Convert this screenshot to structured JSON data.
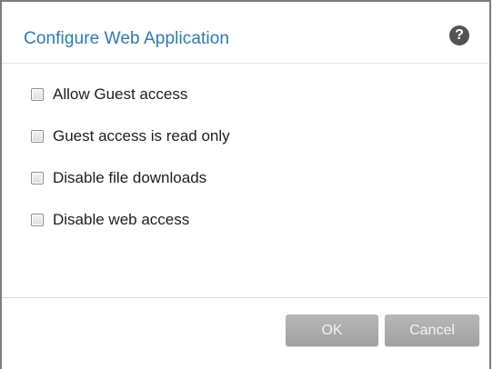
{
  "dialog": {
    "title": "Configure Web Application",
    "help_icon": "help-icon"
  },
  "options": [
    {
      "label": "Allow Guest access",
      "checked": false
    },
    {
      "label": "Guest access is read only",
      "checked": false
    },
    {
      "label": "Disable file downloads",
      "checked": false
    },
    {
      "label": "Disable web access",
      "checked": false
    }
  ],
  "footer": {
    "ok_label": "OK",
    "cancel_label": "Cancel",
    "buttons_disabled": true
  },
  "colors": {
    "title": "#2a7ab7",
    "button": "#a9a9a9"
  }
}
